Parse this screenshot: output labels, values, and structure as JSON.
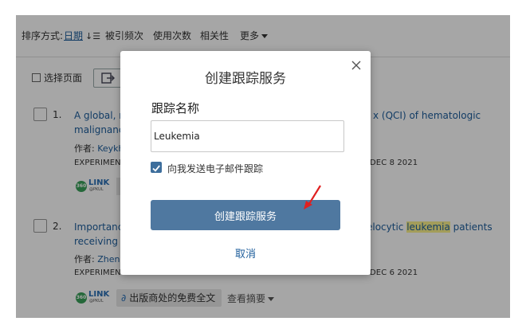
{
  "sort": {
    "label": "排序方式:",
    "date": "日期",
    "date_icon": "↓☰",
    "citations": "被引频次",
    "usage": "使用次数",
    "relevance": "相关性",
    "more": "更多"
  },
  "toolbar": {
    "select_page": "选择页面"
  },
  "results": [
    {
      "num": "1.",
      "title_line1_start": "A global, reg",
      "title_line1_end": "x (QCI) of hematologic",
      "title_line2": "malignanci",
      "author_label": "作者:",
      "author": "Keykha",
      "journal": "EXPERIMENT",
      "date": "DEC 8 2021"
    },
    {
      "num": "2.",
      "title_line1_start": "Importance",
      "title_line1_end_pre": "elocytic ",
      "title_highlight": "leukemia",
      "title_line1_end_post": " patients",
      "title_line2": "receiving th",
      "author_label": "作者:",
      "author": "Zheng",
      "journal": "EXPERIMENT",
      "date": "DEC 6 2021",
      "fulltext": "出版商处的免费全文",
      "abstract": "查看摘要"
    }
  ],
  "link_logo": {
    "badge": "360",
    "word": "LINK",
    "sub": "@PKUL"
  },
  "modal": {
    "title": "创建跟踪服务",
    "field_label": "跟踪名称",
    "name_value": "Leukemia",
    "email_checkbox_label": "向我发送电子邮件跟踪",
    "email_checked": true,
    "create_button": "创建跟踪服务",
    "cancel": "取消"
  },
  "colors": {
    "primary_button": "#4f78a0",
    "link": "#1d5d9b",
    "highlight": "#fbf28a",
    "annotation_arrow": "#e02020"
  }
}
